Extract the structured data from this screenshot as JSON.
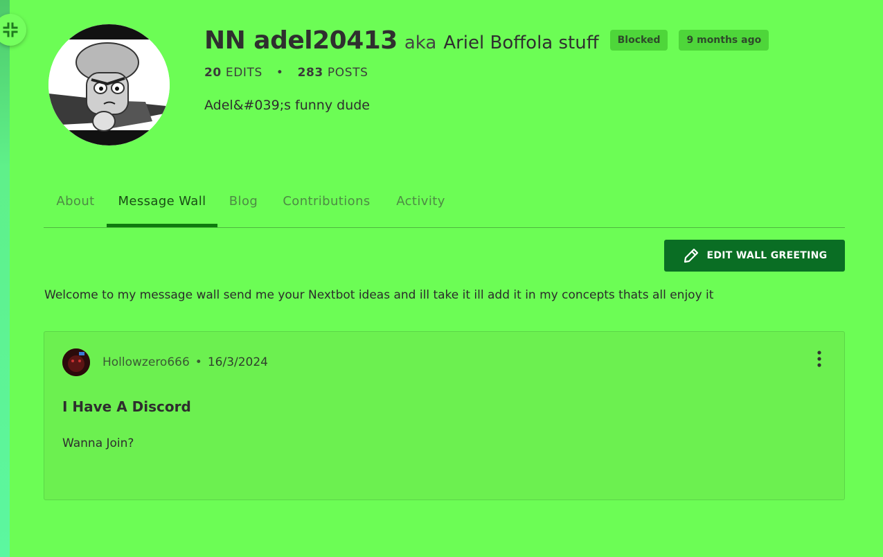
{
  "profile": {
    "username": "NN adel20413",
    "aka_label": "aka",
    "real_name": "Ariel Boffola stuff",
    "tags": [
      "Blocked",
      "9 months ago"
    ],
    "edits_count": "20",
    "edits_label": "EDITS",
    "stats_separator": "•",
    "posts_count": "283",
    "posts_label": "POSTS",
    "bio": "Adel&#039;s funny dude"
  },
  "tabs": [
    {
      "label": "About",
      "active": false
    },
    {
      "label": "Message Wall",
      "active": true
    },
    {
      "label": "Blog",
      "active": false
    },
    {
      "label": "Contributions",
      "active": false
    },
    {
      "label": "Activity",
      "active": false
    }
  ],
  "wall": {
    "edit_button_label": "EDIT WALL GREETING",
    "greeting": "Welcome to my message wall send me your Nextbot ideas and ill take it ill add it in my concepts thats all enjoy it"
  },
  "post": {
    "author": "Hollowzero666",
    "separator": "•",
    "date": "16/3/2024",
    "title": "I Have A Discord",
    "body": "Wanna Join?"
  },
  "icons": {
    "collapse": "collapse-arrows-icon",
    "edit": "pencil-icon",
    "more": "more-vertical-icon"
  },
  "colors": {
    "background": "#6cfd55",
    "button": "#0a6e24",
    "tag": "#4ed63a",
    "active_tab": "#0e7a0e"
  }
}
